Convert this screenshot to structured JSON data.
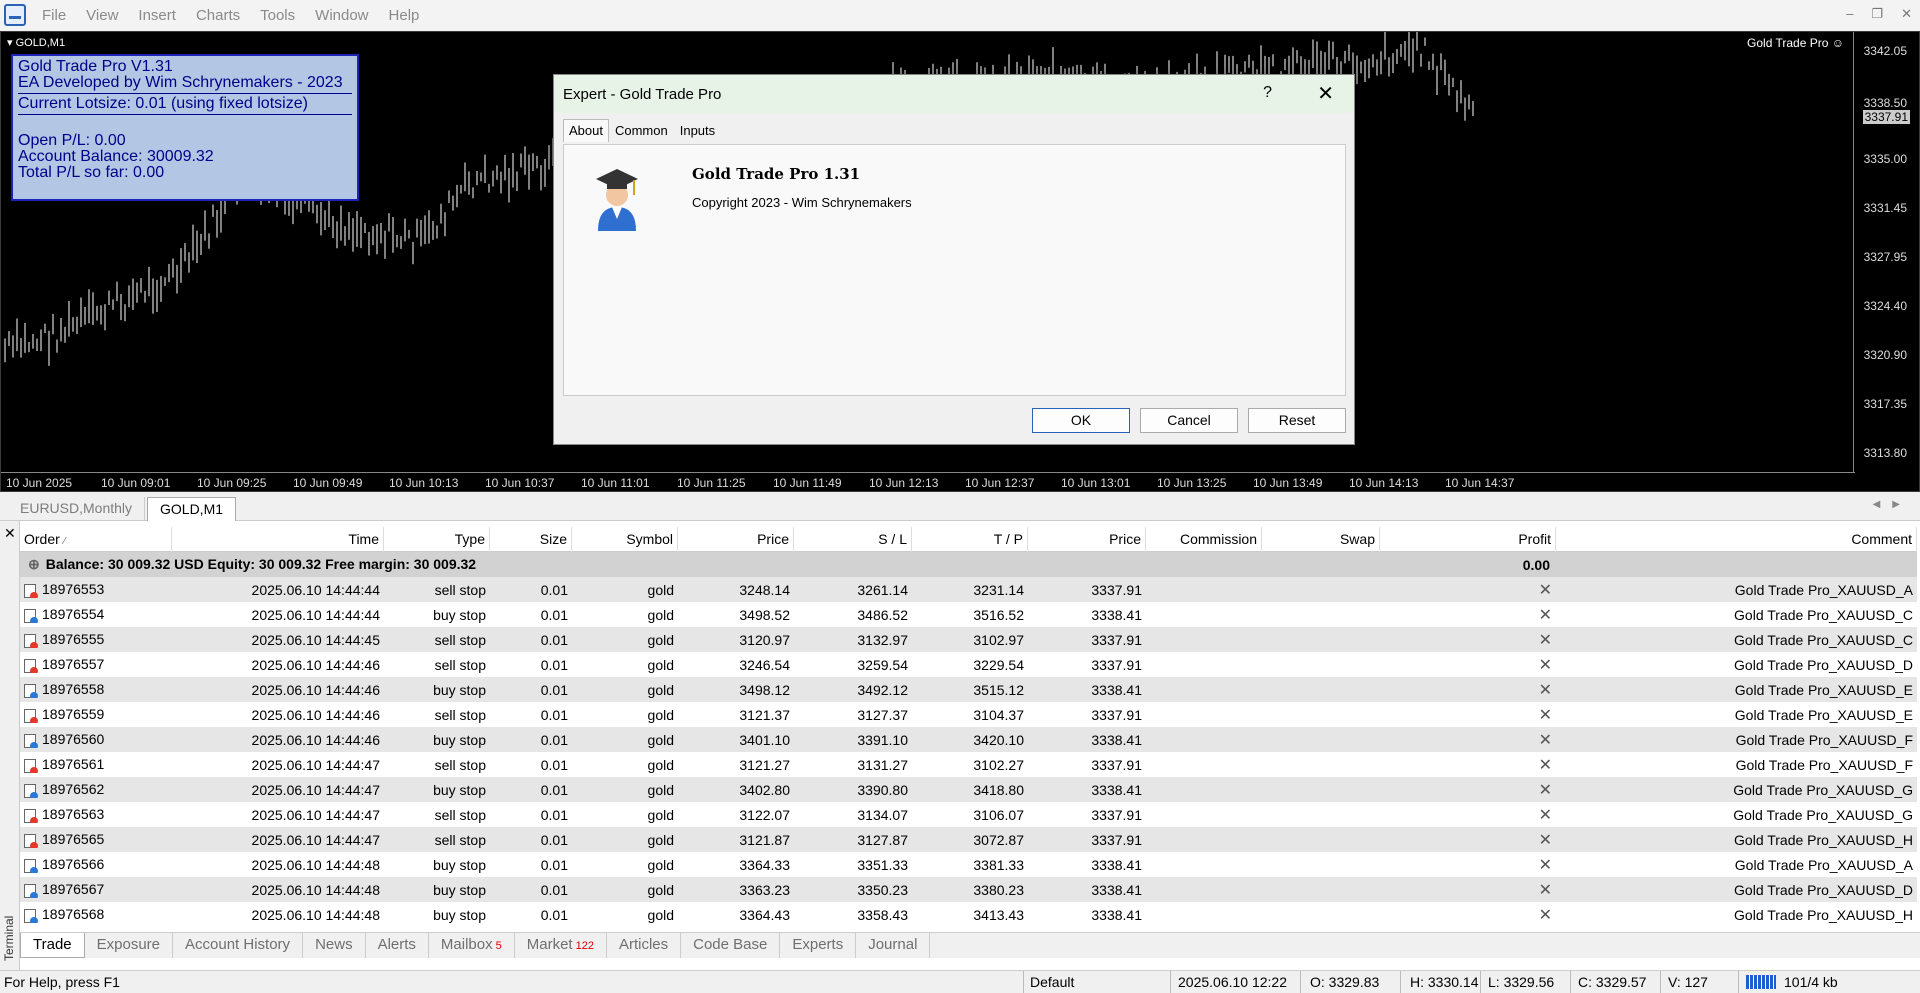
{
  "menubar": {
    "items": [
      "File",
      "View",
      "Insert",
      "Charts",
      "Tools",
      "Window",
      "Help"
    ]
  },
  "chart": {
    "symbol_label": "GOLD,M1",
    "ea_name": "Gold Trade Pro",
    "price_ticks": [
      "3342.05",
      "3338.50",
      "3335.00",
      "3331.45",
      "3327.95",
      "3324.40",
      "3320.90",
      "3317.35",
      "3313.80"
    ],
    "current_price": "3337.91",
    "time_ticks": [
      "10 Jun 2025",
      "10 Jun 09:01",
      "10 Jun 09:25",
      "10 Jun 09:49",
      "10 Jun 10:13",
      "10 Jun 10:37",
      "10 Jun 11:01",
      "10 Jun 11:25",
      "10 Jun 11:49",
      "10 Jun 12:13",
      "10 Jun 12:37",
      "10 Jun 13:01",
      "10 Jun 13:25",
      "10 Jun 13:49",
      "10 Jun 14:13",
      "10 Jun 14:37"
    ]
  },
  "ea_panel": {
    "line1": "Gold Trade Pro V1.31",
    "line2": "EA Developed by Wim Schrynemakers - 2023",
    "line3": "Current Lotsize: 0.01 (using fixed lotsize)",
    "line4": "Open P/L: 0.00",
    "line5": "Account Balance: 30009.32",
    "line6": "Total P/L so far: 0.00"
  },
  "dialog": {
    "title": "Expert - Gold Trade Pro",
    "help": "?",
    "tabs": [
      "About",
      "Common",
      "Inputs"
    ],
    "ea_title": "Gold Trade Pro 1.31",
    "copyright": "Copyright 2023 - Wim Schrynemakers",
    "ok": "OK",
    "cancel": "Cancel",
    "reset": "Reset"
  },
  "chart_tabs": [
    "EURUSD,Monthly",
    "GOLD,M1"
  ],
  "terminal": {
    "side_label": "Terminal",
    "columns": [
      "Order",
      "Time",
      "Type",
      "Size",
      "Symbol",
      "Price",
      "S / L",
      "T / P",
      "Price",
      "Commission",
      "Swap",
      "Profit",
      "Comment"
    ],
    "balance_text": "Balance: 30 009.32 USD  Equity: 30 009.32  Free margin: 30 009.32",
    "balance_profit": "0.00",
    "rows": [
      {
        "order": "18976553",
        "time": "2025.06.10 14:44:44",
        "type": "sell stop",
        "size": "0.01",
        "symbol": "gold",
        "price": "3248.14",
        "sl": "3261.14",
        "tp": "3231.14",
        "cur": "3337.91",
        "comment": "Gold Trade Pro_XAUUSD_A"
      },
      {
        "order": "18976554",
        "time": "2025.06.10 14:44:44",
        "type": "buy stop",
        "size": "0.01",
        "symbol": "gold",
        "price": "3498.52",
        "sl": "3486.52",
        "tp": "3516.52",
        "cur": "3338.41",
        "comment": "Gold Trade Pro_XAUUSD_C"
      },
      {
        "order": "18976555",
        "time": "2025.06.10 14:44:45",
        "type": "sell stop",
        "size": "0.01",
        "symbol": "gold",
        "price": "3120.97",
        "sl": "3132.97",
        "tp": "3102.97",
        "cur": "3337.91",
        "comment": "Gold Trade Pro_XAUUSD_C"
      },
      {
        "order": "18976557",
        "time": "2025.06.10 14:44:46",
        "type": "sell stop",
        "size": "0.01",
        "symbol": "gold",
        "price": "3246.54",
        "sl": "3259.54",
        "tp": "3229.54",
        "cur": "3337.91",
        "comment": "Gold Trade Pro_XAUUSD_D"
      },
      {
        "order": "18976558",
        "time": "2025.06.10 14:44:46",
        "type": "buy stop",
        "size": "0.01",
        "symbol": "gold",
        "price": "3498.12",
        "sl": "3492.12",
        "tp": "3515.12",
        "cur": "3338.41",
        "comment": "Gold Trade Pro_XAUUSD_E"
      },
      {
        "order": "18976559",
        "time": "2025.06.10 14:44:46",
        "type": "sell stop",
        "size": "0.01",
        "symbol": "gold",
        "price": "3121.37",
        "sl": "3127.37",
        "tp": "3104.37",
        "cur": "3337.91",
        "comment": "Gold Trade Pro_XAUUSD_E"
      },
      {
        "order": "18976560",
        "time": "2025.06.10 14:44:46",
        "type": "buy stop",
        "size": "0.01",
        "symbol": "gold",
        "price": "3401.10",
        "sl": "3391.10",
        "tp": "3420.10",
        "cur": "3338.41",
        "comment": "Gold Trade Pro_XAUUSD_F"
      },
      {
        "order": "18976561",
        "time": "2025.06.10 14:44:47",
        "type": "sell stop",
        "size": "0.01",
        "symbol": "gold",
        "price": "3121.27",
        "sl": "3131.27",
        "tp": "3102.27",
        "cur": "3337.91",
        "comment": "Gold Trade Pro_XAUUSD_F"
      },
      {
        "order": "18976562",
        "time": "2025.06.10 14:44:47",
        "type": "buy stop",
        "size": "0.01",
        "symbol": "gold",
        "price": "3402.80",
        "sl": "3390.80",
        "tp": "3418.80",
        "cur": "3338.41",
        "comment": "Gold Trade Pro_XAUUSD_G"
      },
      {
        "order": "18976563",
        "time": "2025.06.10 14:44:47",
        "type": "sell stop",
        "size": "0.01",
        "symbol": "gold",
        "price": "3122.07",
        "sl": "3134.07",
        "tp": "3106.07",
        "cur": "3337.91",
        "comment": "Gold Trade Pro_XAUUSD_G"
      },
      {
        "order": "18976565",
        "time": "2025.06.10 14:44:47",
        "type": "sell stop",
        "size": "0.01",
        "symbol": "gold",
        "price": "3121.87",
        "sl": "3127.87",
        "tp": "3072.87",
        "cur": "3337.91",
        "comment": "Gold Trade Pro_XAUUSD_H"
      },
      {
        "order": "18976566",
        "time": "2025.06.10 14:44:48",
        "type": "buy stop",
        "size": "0.01",
        "symbol": "gold",
        "price": "3364.33",
        "sl": "3351.33",
        "tp": "3381.33",
        "cur": "3338.41",
        "comment": "Gold Trade Pro_XAUUSD_A"
      },
      {
        "order": "18976567",
        "time": "2025.06.10 14:44:48",
        "type": "buy stop",
        "size": "0.01",
        "symbol": "gold",
        "price": "3363.23",
        "sl": "3350.23",
        "tp": "3380.23",
        "cur": "3338.41",
        "comment": "Gold Trade Pro_XAUUSD_D"
      },
      {
        "order": "18976568",
        "time": "2025.06.10 14:44:48",
        "type": "buy stop",
        "size": "0.01",
        "symbol": "gold",
        "price": "3364.43",
        "sl": "3358.43",
        "tp": "3413.43",
        "cur": "3338.41",
        "comment": "Gold Trade Pro_XAUUSD_H"
      }
    ]
  },
  "bottom_tabs": [
    {
      "label": "Trade",
      "badge": ""
    },
    {
      "label": "Exposure",
      "badge": ""
    },
    {
      "label": "Account History",
      "badge": ""
    },
    {
      "label": "News",
      "badge": ""
    },
    {
      "label": "Alerts",
      "badge": ""
    },
    {
      "label": "Mailbox",
      "badge": "5"
    },
    {
      "label": "Market",
      "badge": "122"
    },
    {
      "label": "Articles",
      "badge": ""
    },
    {
      "label": "Code Base",
      "badge": ""
    },
    {
      "label": "Experts",
      "badge": ""
    },
    {
      "label": "Journal",
      "badge": ""
    }
  ],
  "statusbar": {
    "help": "For Help, press F1",
    "profile": "Default",
    "datetime": "2025.06.10 12:22",
    "open": "O: 3329.83",
    "high": "H: 3330.14",
    "low": "L: 3329.56",
    "close": "C: 3329.57",
    "volume": "V: 127",
    "traffic": "101/4 kb"
  },
  "colors": {
    "chart_bg": "#000000",
    "candle": "#ffffff",
    "panel_bg": "#b3c6e3",
    "panel_text": "#00008b",
    "sell_dot": "#e03a2a",
    "buy_dot": "#2a78d6"
  }
}
